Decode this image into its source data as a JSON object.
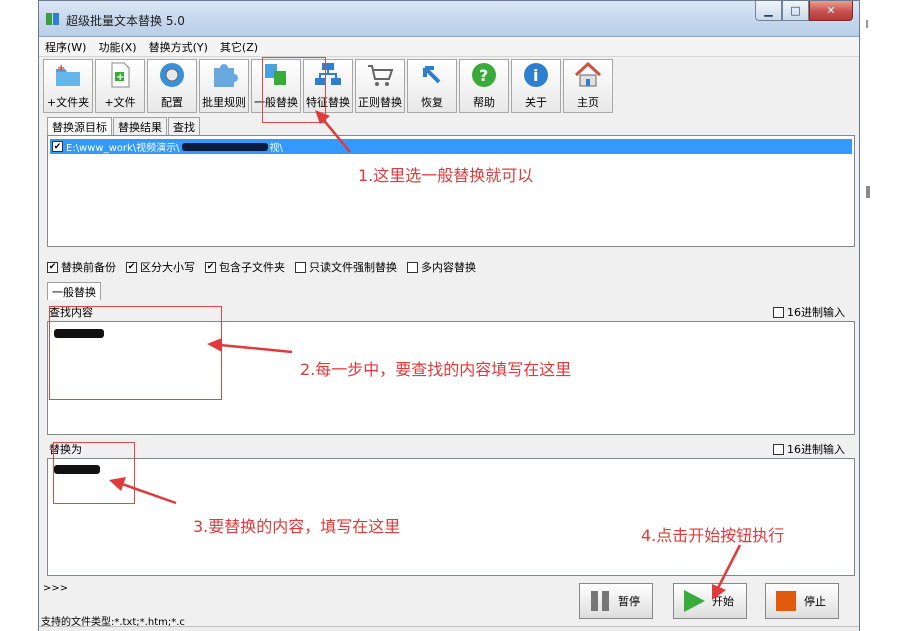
{
  "window": {
    "title": "超级批量文本替换 5.0",
    "buttons": [
      "minimize",
      "maximize",
      "close"
    ]
  },
  "menu": [
    "程序(W)",
    "功能(X)",
    "替换方式(Y)",
    "其它(Z)"
  ],
  "toolbar": [
    {
      "label": "+文件夹",
      "icon": "folder-add-icon"
    },
    {
      "label": "+文件",
      "icon": "file-add-icon"
    },
    {
      "label": "配置",
      "icon": "config-icon"
    },
    {
      "label": "批里规则",
      "icon": "puzzle-icon"
    },
    {
      "label": "一般替换",
      "icon": "general-replace-icon"
    },
    {
      "label": "特征替换",
      "icon": "feature-replace-icon"
    },
    {
      "label": "正则替换",
      "icon": "regex-cart-icon"
    },
    {
      "label": "恢复",
      "icon": "restore-icon"
    },
    {
      "label": "帮助",
      "icon": "help-icon"
    },
    {
      "label": "关于",
      "icon": "info-icon"
    },
    {
      "label": "主页",
      "icon": "home-icon"
    }
  ],
  "source_tabs": [
    "替换源目标",
    "替换结果",
    "查找"
  ],
  "source_item": {
    "checked": true,
    "path_start": "E:\\www_work\\视频演示\\",
    "path_end": "视\\"
  },
  "options": [
    {
      "label": "替换前备份",
      "checked": true
    },
    {
      "label": "区分大小写",
      "checked": true
    },
    {
      "label": "包含子文件夹",
      "checked": true
    },
    {
      "label": "只读文件强制替换",
      "checked": false
    },
    {
      "label": "多内容替换",
      "checked": false
    }
  ],
  "mode_tab": "一般替换",
  "find": {
    "label": "查找内容",
    "hex_label": "16进制输入",
    "hex_checked": false
  },
  "replace": {
    "label": "替换为",
    "hex_label": "16进制输入",
    "hex_checked": false
  },
  "log_prompt": ">>>",
  "status_text": "支持的文件类型:*.txt;*.htm;*.c",
  "controls": {
    "pause": "暂停",
    "start": "开始",
    "stop": "停止"
  },
  "annotations": {
    "a1": "1.这里选一般替换就可以",
    "a2": "2.每一步中，要查找的内容填写在这里",
    "a3": "3.要替换的内容，填写在这里",
    "a4": "4.点击开始按钮执行"
  },
  "colors": {
    "annotation": "#e03a3a",
    "selection": "#3399ff",
    "titlebar": "#c4d6ec",
    "close": "#c75050"
  }
}
